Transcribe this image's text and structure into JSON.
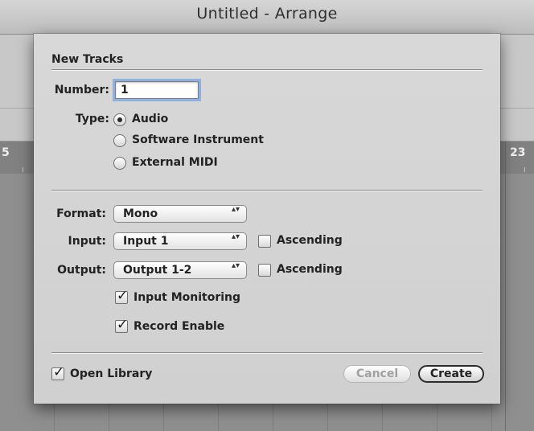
{
  "window": {
    "title": "Untitled - Arrange",
    "ruler_left": "5",
    "ruler_right": "23"
  },
  "dialog": {
    "title": "New Tracks",
    "number_label": "Number:",
    "number_value": "1",
    "type_label": "Type:",
    "type_options": [
      {
        "label": "Audio",
        "selected": true
      },
      {
        "label": "Software Instrument",
        "selected": false
      },
      {
        "label": "External MIDI",
        "selected": false
      }
    ],
    "format_label": "Format:",
    "format_value": "Mono",
    "input_label": "Input:",
    "input_value": "Input 1",
    "input_ascending_label": "Ascending",
    "input_ascending_checked": false,
    "output_label": "Output:",
    "output_value": "Output 1-2",
    "output_ascending_label": "Ascending",
    "output_ascending_checked": false,
    "input_monitoring_label": "Input Monitoring",
    "input_monitoring_checked": true,
    "record_enable_label": "Record Enable",
    "record_enable_checked": true,
    "open_library_label": "Open Library",
    "open_library_checked": true,
    "cancel_label": "Cancel",
    "create_label": "Create",
    "check_glyph": "✓",
    "popup_arrows": "▴▾"
  }
}
